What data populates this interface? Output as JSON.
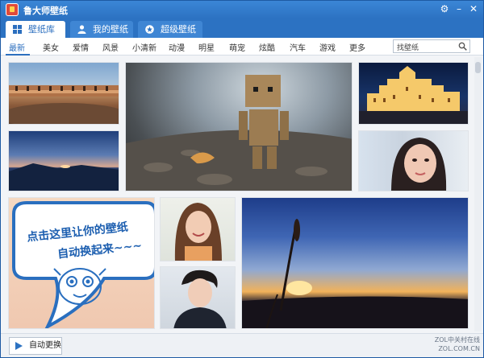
{
  "app": {
    "title": "鲁大师壁纸"
  },
  "tabs": [
    {
      "label": "壁纸库",
      "icon": "grid-icon"
    },
    {
      "label": "我的壁纸",
      "icon": "user-icon"
    },
    {
      "label": "超级壁纸",
      "icon": "star-icon"
    }
  ],
  "categories": [
    "最新",
    "美女",
    "爱情",
    "风景",
    "小清新",
    "动漫",
    "明星",
    "萌宠",
    "炫酷",
    "汽车",
    "游戏",
    "更多"
  ],
  "search": {
    "value": "找壁纸"
  },
  "promo": {
    "line1": "点击这里让你的壁纸",
    "line2": "自动换起来~~~"
  },
  "bottom": {
    "auto_change_label": "自动更换"
  },
  "watermark": {
    "line1": "ZOL中关村在线",
    "line2": "ZOL.COM.CN"
  },
  "colors": {
    "titlebar": "#2c72c2",
    "accent": "#2c6fbf"
  }
}
